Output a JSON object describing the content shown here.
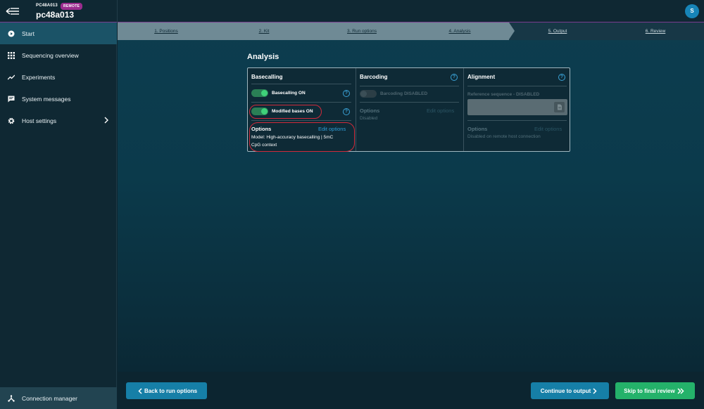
{
  "header": {
    "host_label": "PC48A013",
    "remote_badge": "REMOTE",
    "host_name": "pc48a013",
    "avatar_initial": "S"
  },
  "sidebar": {
    "items": [
      {
        "label": "Start",
        "icon": "play-circle-icon",
        "active": true
      },
      {
        "label": "Sequencing overview",
        "icon": "grid-icon"
      },
      {
        "label": "Experiments",
        "icon": "trend-icon"
      },
      {
        "label": "System messages",
        "icon": "message-icon"
      },
      {
        "label": "Host settings",
        "icon": "gear-icon",
        "has_submenu": true
      }
    ],
    "footer": {
      "label": "Connection manager",
      "icon": "network-icon"
    }
  },
  "stepper": {
    "steps": [
      {
        "label": "1. Positions",
        "state": "done"
      },
      {
        "label": "2. Kit",
        "state": "done"
      },
      {
        "label": "3. Run options",
        "state": "done"
      },
      {
        "label": "4. Analysis",
        "state": "current"
      },
      {
        "label": "5. Output",
        "state": "future"
      },
      {
        "label": "6. Review",
        "state": "future"
      }
    ]
  },
  "analysis": {
    "title": "Analysis",
    "basecalling": {
      "heading": "Basecalling",
      "toggle1_label": "Basecalling ON",
      "toggle2_label": "Modified bases ON",
      "options_title": "Options",
      "edit_label": "Edit options",
      "options_line1": "Model: High-accuracy basecalling | 5mC",
      "options_line2": "CpG context"
    },
    "barcoding": {
      "heading": "Barcoding",
      "toggle_label": "Barcoding DISABLED",
      "options_title": "Options",
      "edit_label": "Edit options",
      "options_text": "Disabled"
    },
    "alignment": {
      "heading": "Alignment",
      "ref_label": "Reference sequence - DISABLED",
      "options_title": "Options",
      "edit_label": "Edit options",
      "options_text": "Disabled on remote host connection"
    }
  },
  "footer_buttons": {
    "back": "Back to run options",
    "continue": "Continue to output",
    "skip": "Skip to final review"
  },
  "colors": {
    "accent_blue": "#167fa7",
    "accent_green": "#24b26a",
    "remote_badge": "#9c2d8f",
    "annotation_red": "#d12a3b"
  }
}
